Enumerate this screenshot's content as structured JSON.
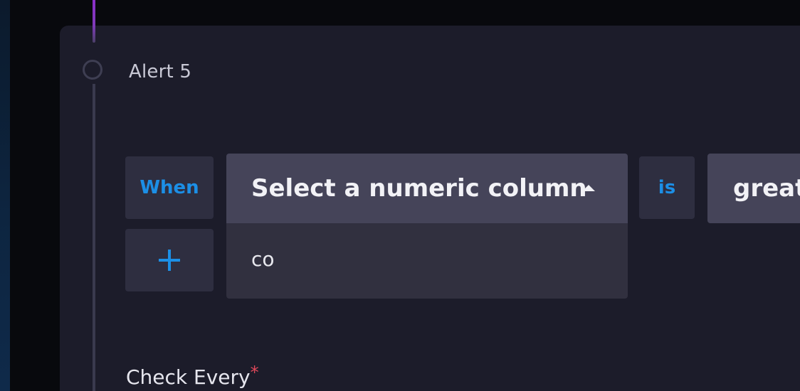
{
  "alert": {
    "title": "Alert 5"
  },
  "condition": {
    "when_label": "When",
    "column_select": {
      "value": "Select a numeric column",
      "search_text": "co"
    },
    "operator_label": "is",
    "comparison_value": "great",
    "add_label": "+"
  },
  "schedule": {
    "check_every_label": "Check Every",
    "required_mark": "*"
  },
  "colors": {
    "accent": "#1c8fe6",
    "timeline_active": "#8b2fc9",
    "required": "#e0485a"
  }
}
